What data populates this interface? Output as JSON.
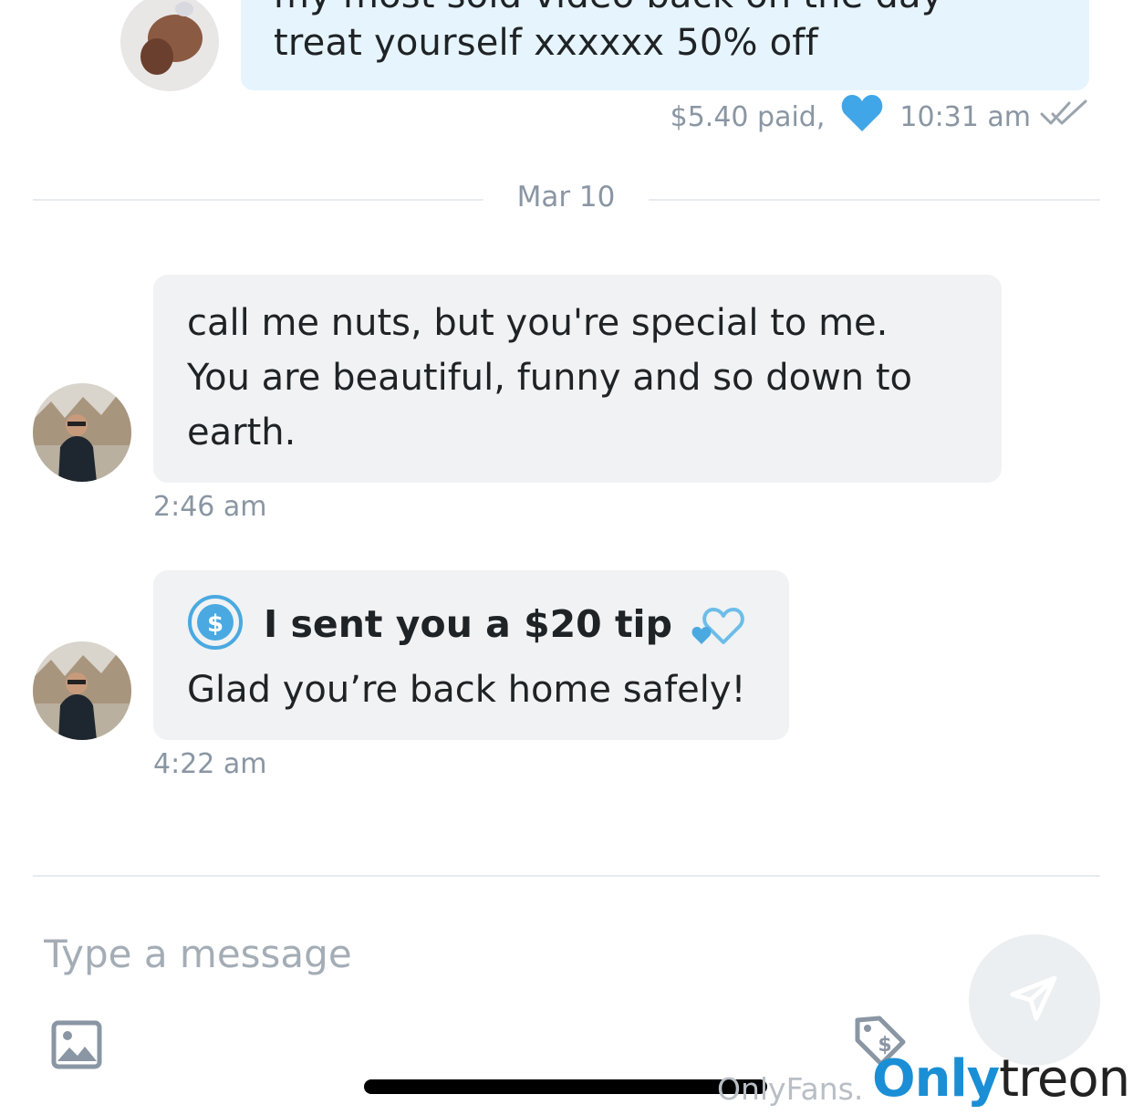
{
  "messages": {
    "outgoing": {
      "line1": "my most sold video back on the day",
      "line2": "treat yourself xxxxxx 50% off",
      "price": "$5.40 paid,",
      "time": "10:31 am"
    },
    "date_separator": "Mar 10",
    "incoming": [
      {
        "lines": [
          "call me nuts, but you're special to me.",
          "You are beautiful, funny and so down to",
          "earth."
        ],
        "time": "2:46 am"
      },
      {
        "tip_title": "I sent you a $20 tip",
        "text": "Glad you’re back home safely!",
        "time": "4:22 am"
      }
    ]
  },
  "composer": {
    "placeholder": "Type a message",
    "value": ""
  },
  "icons": {
    "heart": "heart-icon",
    "read": "double-check-icon",
    "tip": "dollar-circle-icon",
    "hearts": "two-hearts-icon",
    "media": "image-icon",
    "price": "price-tag-icon",
    "send": "send-icon"
  },
  "colors": {
    "accent": "#00aff0",
    "outgoing_bubble": "#e6f4fd",
    "incoming_bubble": "#f0f2f4",
    "muted_text": "#8a96a3"
  },
  "watermark": {
    "site": "OnlyFans.",
    "brand_a": "Only",
    "brand_b": "treon"
  }
}
